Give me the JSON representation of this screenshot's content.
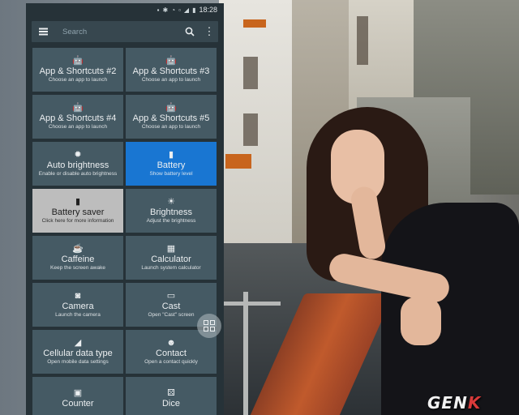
{
  "status_bar": {
    "time": "18:28"
  },
  "search": {
    "placeholder": "Search"
  },
  "tiles": [
    {
      "title": "App & Shortcuts #2",
      "subtitle": "Choose an app to launch",
      "icon": "android-icon"
    },
    {
      "title": "App & Shortcuts #3",
      "subtitle": "Choose an app to launch",
      "icon": "android-icon"
    },
    {
      "title": "App & Shortcuts #4",
      "subtitle": "Choose an app to launch",
      "icon": "android-icon"
    },
    {
      "title": "App & Shortcuts #5",
      "subtitle": "Choose an app to launch",
      "icon": "android-icon"
    },
    {
      "title": "Auto brightness",
      "subtitle": "Enable or disable auto brightness",
      "icon": "auto-brightness-icon"
    },
    {
      "title": "Battery",
      "subtitle": "Show battery level",
      "icon": "battery-icon"
    },
    {
      "title": "Battery saver",
      "subtitle": "Click here for more information",
      "icon": "battery-saver-icon"
    },
    {
      "title": "Brightness",
      "subtitle": "Adjust the brightness",
      "icon": "brightness-icon"
    },
    {
      "title": "Caffeine",
      "subtitle": "Keep the screen awake",
      "icon": "coffee-cup-icon"
    },
    {
      "title": "Calculator",
      "subtitle": "Launch system calculator",
      "icon": "calculator-icon"
    },
    {
      "title": "Camera",
      "subtitle": "Launch the camera",
      "icon": "camera-icon"
    },
    {
      "title": "Cast",
      "subtitle": "Open \"Cast\" screen",
      "icon": "cast-icon"
    },
    {
      "title": "Cellular data type",
      "subtitle": "Open mobile data settings",
      "icon": "signal-icon"
    },
    {
      "title": "Contact",
      "subtitle": "Open a contact quickly",
      "icon": "contact-icon"
    },
    {
      "title": "Counter",
      "subtitle": "",
      "icon": "counter-icon"
    },
    {
      "title": "Dice",
      "subtitle": "",
      "icon": "dice-icon"
    }
  ],
  "colors": {
    "panel": "#263238",
    "tile": "#455a64",
    "active_tile": "#1976d2",
    "disabled_tile": "#bdbdbd"
  },
  "watermark": {
    "text_a": "GEN",
    "text_b": "K"
  }
}
